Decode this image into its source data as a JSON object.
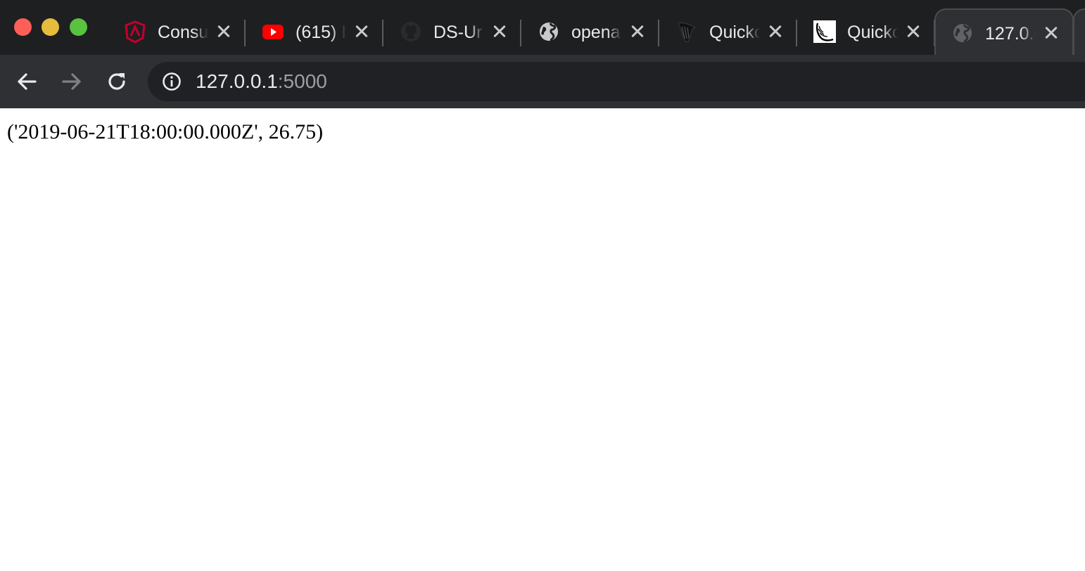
{
  "window": {
    "traffic_lights": {
      "close_color": "#fe5f57",
      "minimize_color": "#e7bc3c",
      "zoom_color": "#59c23f"
    }
  },
  "tabs": [
    {
      "title": "Consu",
      "icon": "angular-shield-icon",
      "icon_color": "#c3002f",
      "active": false
    },
    {
      "title": "(615) I",
      "icon": "youtube-icon",
      "icon_color": "#ff0000",
      "active": false
    },
    {
      "title": "DS-Ur",
      "icon": "github-icon",
      "icon_color": "#2a2b2d",
      "active": false
    },
    {
      "title": "opena",
      "icon": "globe-icon",
      "icon_color": "#c7c9cc",
      "active": false
    },
    {
      "title": "Quickc",
      "icon": "harp-icon",
      "icon_color": "#111111",
      "active": false
    },
    {
      "title": "Quickc",
      "icon": "flask-icon",
      "icon_color": "#ffffff",
      "active": false
    },
    {
      "title": "127.0.0",
      "icon": "globe-icon",
      "icon_color": "#5f6368",
      "active": true
    }
  ],
  "toolbar": {
    "back_icon": "arrow-left-icon",
    "forward_icon": "arrow-right-icon",
    "reload_icon": "reload-icon",
    "url_host": "127.0.0.1",
    "url_port": ":5000"
  },
  "page": {
    "body_text": "('2019-06-21T18:00:00.000Z', 26.75)"
  }
}
